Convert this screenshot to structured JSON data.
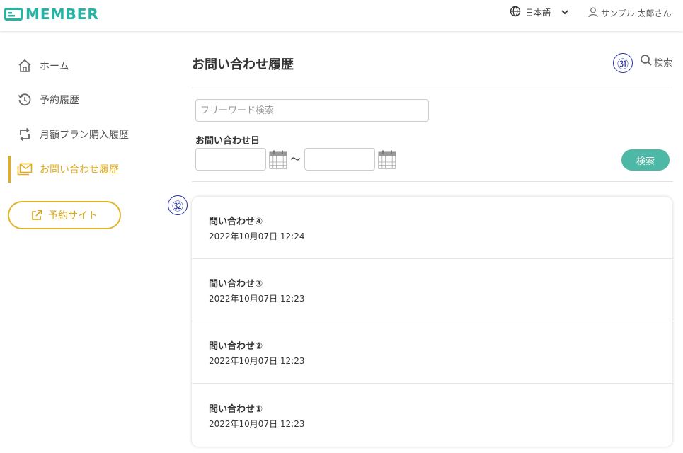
{
  "header": {
    "logo_text": "MEMBER",
    "language": "日本語",
    "user_name": "サンプル 太郎さん",
    "brand_color": "#26b3a4"
  },
  "sidebar": {
    "items": [
      {
        "label": "ホーム",
        "icon": "home-icon"
      },
      {
        "label": "予約履歴",
        "icon": "history-icon"
      },
      {
        "label": "月額プラン購入履歴",
        "icon": "repeat-icon"
      },
      {
        "label": "お問い合わせ履歴",
        "icon": "mail-icon",
        "active": true
      }
    ],
    "reserve_button": "予約サイト",
    "accent_color": "#e0ad1c"
  },
  "main": {
    "title": "お問い合わせ履歴",
    "search_toggle": "検索",
    "search": {
      "free_word_placeholder": "フリーワード検索",
      "date_label": "お問い合わせ日",
      "range_separator": "～",
      "search_button": "検索",
      "date_from": "",
      "date_to": ""
    },
    "inquiries": [
      {
        "title": "問い合わせ④",
        "date": "2022年10月07日 12:24"
      },
      {
        "title": "問い合わせ③",
        "date": "2022年10月07日 12:23"
      },
      {
        "title": "問い合わせ②",
        "date": "2022年10月07日 12:23"
      },
      {
        "title": "問い合わせ①",
        "date": "2022年10月07日 12:23"
      }
    ]
  },
  "annotations": {
    "marker_31": "㉛",
    "marker_32": "㉜"
  }
}
